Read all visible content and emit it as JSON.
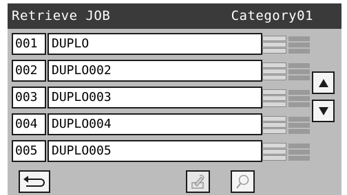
{
  "header": {
    "title": "Retrieve JOB",
    "category": "Category01"
  },
  "jobs": [
    {
      "number": "001",
      "name": "DUPLO"
    },
    {
      "number": "002",
      "name": "DUPLO002"
    },
    {
      "number": "003",
      "name": "DUPLO003"
    },
    {
      "number": "004",
      "name": "DUPLO004"
    },
    {
      "number": "005",
      "name": "DUPLO005"
    }
  ],
  "icons": {
    "row_status_left": "storage-lines-icon",
    "row_status_right": "solid-lines-icon",
    "scroll_up": "up-triangle-icon",
    "scroll_down": "down-triangle-icon",
    "back": "return-arrow-icon",
    "edit": "edit-pencil-icon",
    "search": "magnifier-icon"
  },
  "colors": {
    "title_bar": "#3a3a3a",
    "background": "#bcbcbc",
    "field": "#ffffff",
    "border": "#1c1c1c"
  }
}
